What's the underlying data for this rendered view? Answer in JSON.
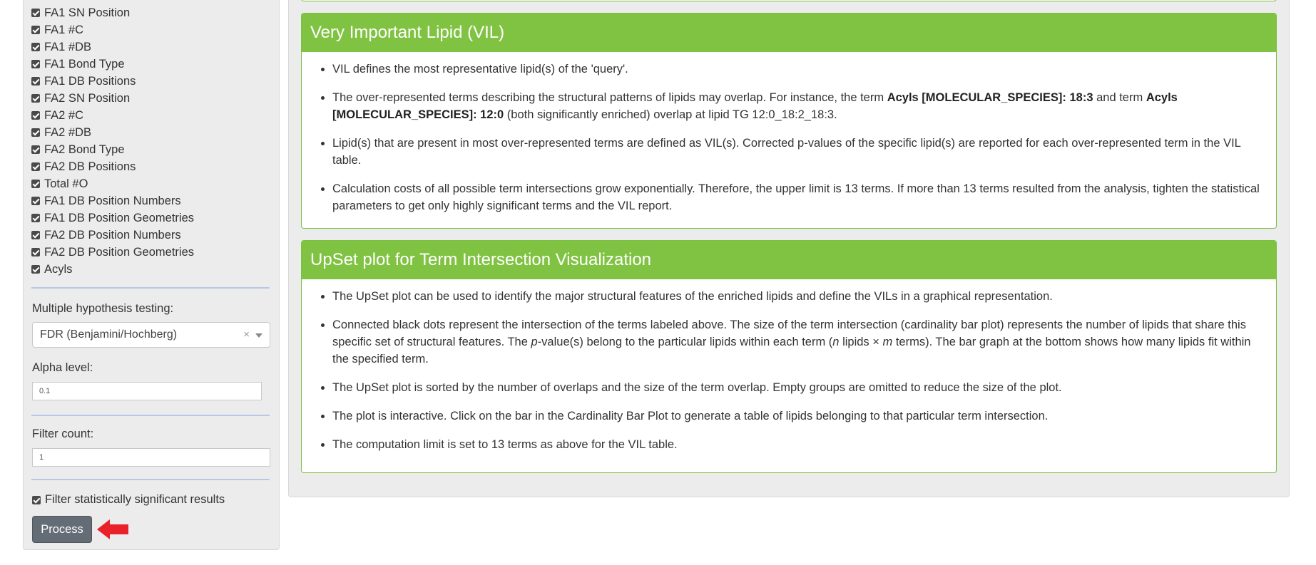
{
  "sidebar": {
    "checkbox_items": [
      {
        "label": "FA1 SN Position",
        "checked": true
      },
      {
        "label": "FA1 #C",
        "checked": true
      },
      {
        "label": "FA1 #DB",
        "checked": true
      },
      {
        "label": "FA1 Bond Type",
        "checked": true
      },
      {
        "label": "FA1 DB Positions",
        "checked": true
      },
      {
        "label": "FA2 SN Position",
        "checked": true
      },
      {
        "label": "FA2 #C",
        "checked": true
      },
      {
        "label": "FA2 #DB",
        "checked": true
      },
      {
        "label": "FA2 Bond Type",
        "checked": true
      },
      {
        "label": "FA2 DB Positions",
        "checked": true
      },
      {
        "label": "Total #O",
        "checked": true
      },
      {
        "label": "FA1 DB Position Numbers",
        "checked": true
      },
      {
        "label": "FA1 DB Position Geometries",
        "checked": true
      },
      {
        "label": "FA2 DB Position Numbers",
        "checked": true
      },
      {
        "label": "FA2 DB Position Geometries",
        "checked": true
      },
      {
        "label": "Acyls",
        "checked": true
      }
    ],
    "multiple_testing": {
      "label": "Multiple hypothesis testing:",
      "value": "FDR (Benjamini/Hochberg)",
      "clear_glyph": "×"
    },
    "alpha": {
      "label": "Alpha level:",
      "value": "0.1"
    },
    "filter_count": {
      "label": "Filter count:",
      "value": "1"
    },
    "filter_significant": {
      "label": "Filter statistically significant results",
      "checked": true
    },
    "process_button": "Process",
    "colors": {
      "button": "#646c75",
      "arrow": "#e8212a"
    }
  },
  "vil_card": {
    "title": "Very Important Lipid (VIL)",
    "items": [
      {
        "text": "VIL defines the most representative lipid(s) of the 'query'."
      },
      {
        "t1": "The over-represented terms describing the structural patterns of lipids may overlap. For instance, the term ",
        "b1": "Acyls [MOLECULAR_SPECIES]: 18:3",
        "t2": " and term ",
        "b2": "Acyls [MOLECULAR_SPECIES]: 12:0",
        "t3": " (both significantly enriched) overlap at lipid TG 12:0_18:2_18:3."
      },
      {
        "text": "Lipid(s) that are present in most over-represented terms are defined as VIL(s). Corrected p-values of the specific lipid(s) are reported for each over-represented term in the VIL table."
      },
      {
        "text": "Calculation costs of all possible term intersections grow exponentially. Therefore, the upper limit is 13 terms. If more than 13 terms resulted from the analysis, tighten the statistical parameters to get only highly significant terms and the VIL report."
      }
    ]
  },
  "upset_card": {
    "title": "UpSet plot for Term Intersection Visualization",
    "items": [
      {
        "text": "The UpSet plot can be used to identify the major structural features of the enriched lipids and define the VILs in a graphical representation."
      },
      {
        "t1": "Connected black dots represent the intersection of the terms labeled above. The size of the term intersection (cardinality bar plot) represents the number of lipids that share this specific set of structural features. The ",
        "i1": "p",
        "t2": "-value(s) belong to the particular lipids within each term (",
        "i2": "n",
        "t3": " lipids × ",
        "i3": "m",
        "t4": " terms). The bar graph at the bottom shows how many lipids fit within the specified term."
      },
      {
        "text": "The UpSet plot is sorted by the number of overlaps and the size of the term overlap. Empty groups are omitted to reduce the size of the plot."
      },
      {
        "text": "The plot is interactive. Click on the bar in the Cardinality Bar Plot to generate a table of lipids belonging to that particular term intersection."
      },
      {
        "text": "The computation limit is set to 13 terms as above for the VIL table."
      }
    ]
  },
  "colors": {
    "card_header": "#80c342",
    "card_border": "#7cc042",
    "panel_bg": "#ececec"
  }
}
